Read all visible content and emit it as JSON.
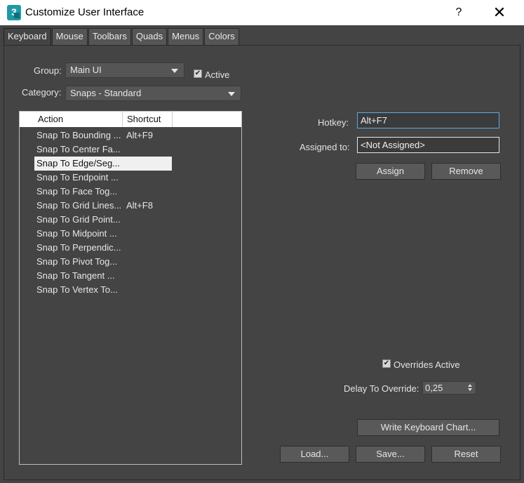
{
  "window": {
    "title": "Customize User Interface",
    "app_icon": "3ds-max-icon",
    "help_label": "?",
    "close_label": "✕"
  },
  "tabs": [
    {
      "label": "Keyboard",
      "active": true
    },
    {
      "label": "Mouse"
    },
    {
      "label": "Toolbars"
    },
    {
      "label": "Quads"
    },
    {
      "label": "Menus"
    },
    {
      "label": "Colors"
    }
  ],
  "group": {
    "label": "Group:",
    "value": "Main UI",
    "active_label": "Active",
    "active_checked": true
  },
  "category": {
    "label": "Category:",
    "value": "Snaps - Standard"
  },
  "list": {
    "headers": {
      "action": "Action",
      "shortcut": "Shortcut"
    },
    "rows": [
      {
        "action": "Snap To Bounding ...",
        "shortcut": "Alt+F9"
      },
      {
        "action": "Snap To Center Fa...",
        "shortcut": ""
      },
      {
        "action": "Snap To Edge/Seg...",
        "shortcut": "",
        "selected": true
      },
      {
        "action": "Snap To Endpoint ...",
        "shortcut": ""
      },
      {
        "action": "Snap To Face Tog...",
        "shortcut": ""
      },
      {
        "action": "Snap To Grid Lines...",
        "shortcut": "Alt+F8"
      },
      {
        "action": "Snap To Grid Point...",
        "shortcut": ""
      },
      {
        "action": "Snap To Midpoint ...",
        "shortcut": ""
      },
      {
        "action": "Snap To Perpendic...",
        "shortcut": ""
      },
      {
        "action": "Snap To Pivot Tog...",
        "shortcut": ""
      },
      {
        "action": "Snap To Tangent ...",
        "shortcut": ""
      },
      {
        "action": "Snap To Vertex To...",
        "shortcut": ""
      }
    ]
  },
  "hotkey": {
    "label": "Hotkey:",
    "value": "Alt+F7"
  },
  "assigned": {
    "label": "Assigned to:",
    "value": "<Not Assigned>"
  },
  "buttons": {
    "assign": "Assign",
    "remove": "Remove",
    "write_chart": "Write Keyboard Chart...",
    "load": "Load...",
    "save": "Save...",
    "reset": "Reset"
  },
  "overrides": {
    "label": "Overrides Active",
    "checked": true
  },
  "delay": {
    "label": "Delay To Override:",
    "value": "0,25"
  },
  "colors": {
    "dialog_bg": "#444444",
    "selection": "#f0f0f0",
    "focus_border": "#5aa9e6"
  }
}
